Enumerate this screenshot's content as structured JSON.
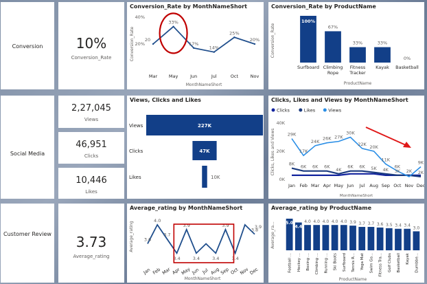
{
  "rows": {
    "conversion": {
      "label": "Conversion",
      "kpi_value": "10%",
      "kpi_label": "Conversion_Rate"
    },
    "social": {
      "label": "Social Media",
      "kpis": [
        {
          "value": "2,27,045",
          "label": "Views"
        },
        {
          "value": "46,951",
          "label": "Clicks"
        },
        {
          "value": "10,446",
          "label": "Likes"
        }
      ]
    },
    "review": {
      "label": "Customer Review",
      "kpi_value": "3.73",
      "kpi_label": "Average_rating"
    }
  },
  "charts": {
    "conv_month": {
      "title": "Conversion_Rate by MonthNameShort"
    },
    "conv_product": {
      "title": "Conversion_Rate by ProductName"
    },
    "vcl": {
      "title": "Views, Clicks and Likes"
    },
    "clv_month": {
      "title": "Clicks, Likes and Views by MonthNameShort"
    },
    "rating_month": {
      "title": "Average_rating by MonthNameShort"
    },
    "rating_product": {
      "title": "Average_rating by ProductName"
    }
  },
  "chart_data": [
    {
      "type": "line",
      "title": "Conversion_Rate by MonthNameShort",
      "xlabel": "MonthNameShort",
      "ylabel": "Conversion_Rate",
      "categories": [
        "Mar",
        "May",
        "Jun",
        "Jul",
        "Oct",
        "Nov"
      ],
      "ytick_labels": [
        "20%",
        "40%"
      ],
      "values": [
        20,
        33,
        17,
        14,
        25,
        20
      ],
      "data_labels": [
        "20",
        "33%",
        "17%",
        "14%",
        "25%",
        "20%"
      ],
      "ylim": [
        0,
        40
      ]
    },
    {
      "type": "bar",
      "title": "Conversion_Rate by ProductName",
      "xlabel": "ProductName",
      "ylabel": "Conversion_Rate",
      "categories": [
        "Surfboard",
        "Climbing Rope",
        "Fitness Tracker",
        "Kayak",
        "Basketball"
      ],
      "values": [
        100,
        67,
        33,
        33,
        0
      ],
      "data_labels": [
        "100%",
        "67%",
        "33%",
        "33%",
        "0%"
      ],
      "ylim": [
        0,
        100
      ]
    },
    {
      "type": "bar",
      "title": "Views, Clicks and Likes",
      "orientation": "horizontal",
      "categories": [
        "Views",
        "Clicks",
        "Likes"
      ],
      "values": [
        227000,
        47000,
        10000
      ],
      "data_labels": [
        "227K",
        "47K",
        "10K"
      ]
    },
    {
      "type": "line",
      "title": "Clicks, Likes and Views by MonthNameShort",
      "xlabel": "MonthNameShort",
      "ylabel": "Clicks, Likes and Views",
      "legend": "top-left",
      "categories": [
        "Jan",
        "Feb",
        "Mar",
        "Apr",
        "May",
        "Jun",
        "Jul",
        "Aug",
        "Sep",
        "Oct",
        "Nov",
        "Dec"
      ],
      "ytick_labels": [
        "0K",
        "20K",
        "40K"
      ],
      "ylim": [
        0,
        40
      ],
      "series": [
        {
          "name": "Clicks",
          "color": "#12239e",
          "values": [
            3,
            3,
            3,
            3,
            3,
            4,
            4,
            4,
            3,
            3,
            3,
            3
          ]
        },
        {
          "name": "Likes",
          "color": "#1a3a7e",
          "values": [
            8,
            6,
            6,
            6,
            4,
            6,
            6,
            5,
            4,
            3,
            3,
            2
          ]
        },
        {
          "name": "Views",
          "color": "#2a8ee6",
          "values": [
            29,
            17,
            24,
            26,
            27,
            30,
            22,
            20,
            11,
            6,
            2,
            9
          ]
        }
      ],
      "value_labels": [
        {
          "text": "29K",
          "series": "Views",
          "i": 0
        },
        {
          "text": "17K",
          "series": "Views",
          "i": 1
        },
        {
          "text": "24K",
          "series": "Views",
          "i": 2
        },
        {
          "text": "26K",
          "series": "Views",
          "i": 3
        },
        {
          "text": "27K",
          "series": "Views",
          "i": 4
        },
        {
          "text": "30K",
          "series": "Views",
          "i": 5
        },
        {
          "text": "22K",
          "series": "Views",
          "i": 6
        },
        {
          "text": "20K",
          "series": "Views",
          "i": 7
        },
        {
          "text": "11K",
          "series": "Views",
          "i": 8
        },
        {
          "text": "6K",
          "series": "Views",
          "i": 9
        },
        {
          "text": "9K",
          "series": "Views",
          "i": 11
        },
        {
          "text": "8K",
          "series": "Likes",
          "i": 0
        },
        {
          "text": "6K",
          "series": "Likes",
          "i": 1
        },
        {
          "text": "6K",
          "series": "Likes",
          "i": 2
        },
        {
          "text": "6K",
          "series": "Likes",
          "i": 3
        },
        {
          "text": "4K",
          "series": "Likes",
          "i": 4
        },
        {
          "text": "6K",
          "series": "Likes",
          "i": 5
        },
        {
          "text": "6K",
          "series": "Likes",
          "i": 6
        },
        {
          "text": "5K",
          "series": "Likes",
          "i": 7
        },
        {
          "text": "4K",
          "series": "Likes",
          "i": 8
        },
        {
          "text": "3K",
          "series": "Likes",
          "i": 9
        },
        {
          "text": "2K",
          "series": "Likes",
          "i": 10
        },
        {
          "text": "2K",
          "series": "Likes",
          "i": 11
        }
      ]
    },
    {
      "type": "line",
      "title": "Average_rating by MonthNameShort",
      "xlabel": "MonthNameShort",
      "ylabel": "Average_rating",
      "categories": [
        "Jan",
        "Feb",
        "Mar",
        "Apr",
        "May",
        "Jun",
        "Jul",
        "Aug",
        "Sep",
        "Oct",
        "Nov",
        "Dec"
      ],
      "values": [
        3.6,
        4.0,
        3.7,
        3.4,
        3.9,
        3.4,
        3.6,
        3.4,
        3.9,
        3.4,
        4.0,
        3.8
      ],
      "data_labels": [
        "3.6",
        "4.0",
        "3.7",
        "3.4",
        "3.9",
        "3.4",
        "",
        "3.4",
        "3.9",
        "3.4",
        "",
        "3.8"
      ],
      "end_label": "3.9",
      "ylim": [
        3.2,
        4.1
      ]
    },
    {
      "type": "bar",
      "title": "Average_rating by ProductName",
      "xlabel": "ProductName",
      "ylabel": "Average_ra...",
      "categories": [
        "Football ...",
        "Hockey ...",
        "Boxing ...",
        "Climbing ...",
        "Running ...",
        "Ski Boots",
        "Surfboard",
        "Tennis R...",
        "Yoga Mat",
        "Swim Go...",
        "Fitness Tra...",
        "Golf Clubs",
        "Basketball",
        "Kayak",
        "Dumbbe..."
      ],
      "values": [
        5.0,
        4.4,
        4.0,
        4.0,
        4.0,
        4.0,
        4.0,
        3.9,
        3.7,
        3.7,
        3.6,
        3.5,
        3.4,
        3.4,
        3.0
      ],
      "data_labels": [
        "5.0",
        "4.4",
        "4.0",
        "4.0",
        "4.0",
        "4.0",
        "4.0",
        "3.9",
        "3.7",
        "3.7",
        "3.6",
        "3.5",
        "3.4",
        "3.4",
        "3.0"
      ],
      "ylim": [
        0,
        5
      ]
    }
  ],
  "annotations": {
    "circle_color": "#c00000",
    "rect_color": "#c00000",
    "arrow_color": "#e01818"
  },
  "colors": {
    "bar": "#123f88",
    "line": "#1f4e8c",
    "views": "#2a8ee6"
  }
}
